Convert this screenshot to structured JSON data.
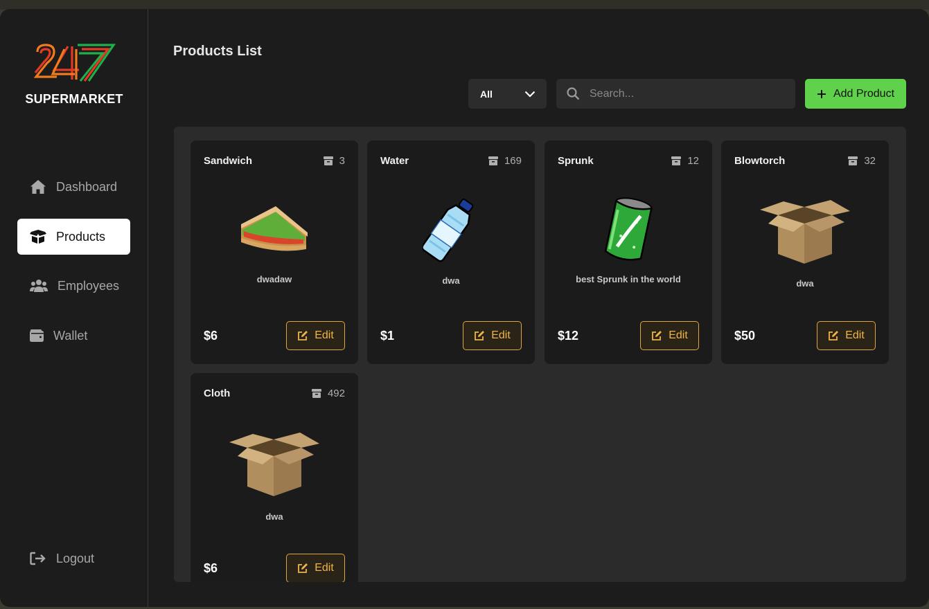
{
  "app": {
    "brand": "SUPERMARKET",
    "logo_text": "24/7",
    "accent": "#5fd14a",
    "edit_color": "#f0b34a"
  },
  "sidebar": {
    "items": [
      {
        "label": "Dashboard",
        "icon": "home-icon",
        "active": false
      },
      {
        "label": "Products",
        "icon": "box-icon",
        "active": true
      },
      {
        "label": "Employees",
        "icon": "users-icon",
        "active": false
      },
      {
        "label": "Wallet",
        "icon": "wallet-icon",
        "active": false
      }
    ],
    "logout_label": "Logout"
  },
  "main": {
    "title": "Products List",
    "filter": {
      "selected": "All"
    },
    "search": {
      "placeholder": "Search...",
      "value": ""
    },
    "add_label": "Add Product",
    "edit_label": "Edit",
    "products": [
      {
        "name": "Sandwich",
        "stock": "3",
        "description": "dwadaw",
        "price": "$6",
        "image": "sandwich"
      },
      {
        "name": "Water",
        "stock": "169",
        "description": "dwa",
        "price": "$1",
        "image": "water-bottle"
      },
      {
        "name": "Sprunk",
        "stock": "12",
        "description": "best Sprunk in the world",
        "price": "$12",
        "image": "sprunk-can"
      },
      {
        "name": "Blowtorch",
        "stock": "32",
        "description": "dwa",
        "price": "$50",
        "image": "cardboard-box"
      },
      {
        "name": "Cloth",
        "stock": "492",
        "description": "dwa",
        "price": "$6",
        "image": "cardboard-box"
      }
    ]
  }
}
